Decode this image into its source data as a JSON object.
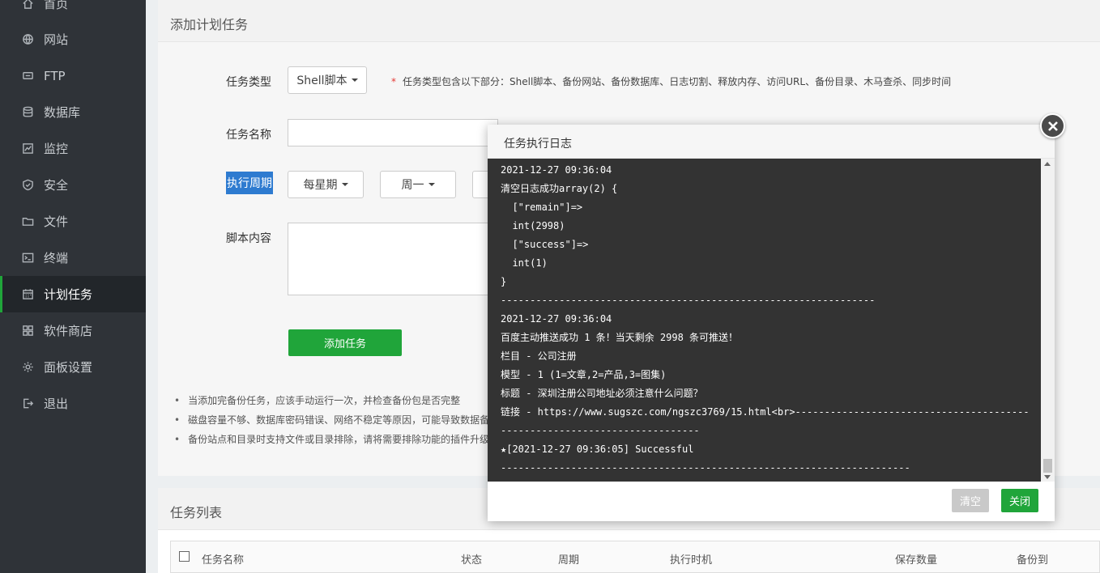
{
  "sidebar": {
    "items": [
      {
        "label": "首页",
        "icon": "home-icon"
      },
      {
        "label": "网站",
        "icon": "globe-icon"
      },
      {
        "label": "FTP",
        "icon": "ftp-icon"
      },
      {
        "label": "数据库",
        "icon": "database-icon"
      },
      {
        "label": "监控",
        "icon": "monitor-icon"
      },
      {
        "label": "安全",
        "icon": "shield-icon"
      },
      {
        "label": "文件",
        "icon": "folder-icon"
      },
      {
        "label": "终端",
        "icon": "terminal-icon"
      },
      {
        "label": "计划任务",
        "icon": "calendar-icon",
        "active": true
      },
      {
        "label": "软件商店",
        "icon": "grid-icon"
      },
      {
        "label": "面板设置",
        "icon": "gear-icon"
      },
      {
        "label": "退出",
        "icon": "logout-icon"
      }
    ]
  },
  "form": {
    "title": "添加计划任务",
    "task_type_label": "任务类型",
    "task_type_value": "Shell脚本",
    "task_type_hint_star": "*",
    "task_type_hint": "任务类型包含以下部分：Shell脚本、备份网站、备份数据库、日志切割、释放内存、访问URL、备份目录、木马查杀、同步时间",
    "task_name_label": "任务名称",
    "task_name_value": "",
    "cycle_label": "执行周期",
    "cycle_value": "每星期",
    "weekday_value": "周一",
    "script_label": "脚本内容",
    "add_button": "添加任务",
    "notes": [
      "当添加完备份任务，应该手动运行一次，并检查备份包是否完整",
      "磁盘容量不够、数据库密码错误、网络不稳定等原因，可能导致数据备",
      "备份站点和目录时支持文件或目录排除，请将需要排除功能的插件升级"
    ]
  },
  "task_list": {
    "title": "任务列表",
    "columns": [
      "任务名称",
      "状态",
      "周期",
      "执行时机",
      "保存数量",
      "备份到"
    ]
  },
  "modal": {
    "title": "任务执行日志",
    "log_lines": [
      "2021-12-27 09:36:04",
      "清空日志成功array(2) {",
      "  [\"remain\"]=>",
      "  int(2998)",
      "  [\"success\"]=>",
      "  int(1)",
      "}",
      "----------------------------------------------------------------",
      "2021-12-27 09:36:04",
      "百度主动推送成功 1 条！当天剩余 2998 条可推送！",
      "栏目 - 公司注册",
      "模型 - 1 (1=文章,2=产品,3=图集)",
      "标题 - 深圳注册公司地址必须注意什么问题？",
      "链接 - https://www.sugszc.com/ngszc3769/15.html<br>----------------------------------------",
      "----------------------------------",
      "★[2021-12-27 09:36:05] Successful",
      "----------------------------------------------------------------------"
    ],
    "clear_button": "清空",
    "close_button": "关闭"
  },
  "colors": {
    "sidebar_bg": "#2f3338",
    "accent_green": "#20a53a",
    "highlight_blue": "#2e7bd0",
    "log_bg": "#333333"
  }
}
